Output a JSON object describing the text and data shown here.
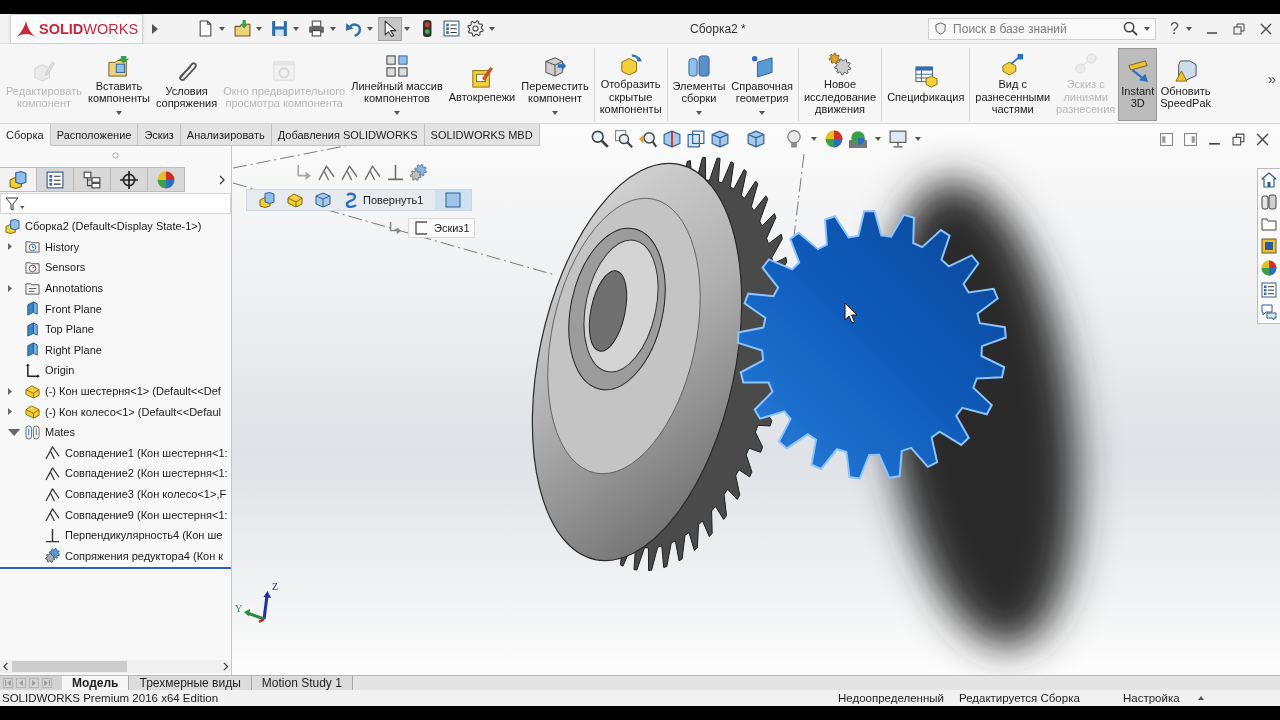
{
  "title_bar": {
    "logo": "**SOLID**WORKS",
    "title": "Сборка2 *",
    "search": {
      "placeholder": "Поиск в базе знаний"
    },
    "help": "?"
  },
  "quick_access": [
    {
      "kind": "new",
      "dropdown": true,
      "pressed": false
    },
    {
      "kind": "open",
      "dropdown": true,
      "pressed": false
    },
    {
      "kind": "save",
      "dropdown": true,
      "pressed": false
    },
    {
      "kind": "print",
      "dropdown": true,
      "pressed": false
    },
    {
      "kind": "undo",
      "dropdown": true,
      "pressed": false
    },
    {
      "kind": "select",
      "dropdown": true,
      "pressed": true
    },
    {
      "kind": "rebuild",
      "dropdown": false,
      "pressed": false
    },
    {
      "kind": "file-properties",
      "dropdown": false,
      "pressed": false
    },
    {
      "kind": "options",
      "dropdown": true,
      "pressed": false
    }
  ],
  "ribbon": {
    "groups": [
      {
        "buttons": [
          {
            "label": "Редактировать\nкомпонент",
            "kind": "edit-component",
            "disabled": true,
            "dropdown": false,
            "selected": false
          },
          {
            "label": "Вставить\nкомпоненты",
            "kind": "insert-components",
            "disabled": false,
            "dropdown": true,
            "selected": false
          },
          {
            "label": "Условия\nсопряжения",
            "kind": "mate",
            "disabled": false,
            "dropdown": false,
            "selected": false
          },
          {
            "label": "Окно предварительного\nпросмотра компонента",
            "kind": "preview",
            "disabled": true,
            "dropdown": false,
            "selected": false
          },
          {
            "label": "Линейный массив\nкомпонентов",
            "kind": "linear-pattern",
            "disabled": false,
            "dropdown": true,
            "selected": false
          },
          {
            "label": "Автокрепежи",
            "kind": "smart-fasteners",
            "disabled": false,
            "dropdown": false,
            "selected": false
          },
          {
            "label": "Переместить\nкомпонент",
            "kind": "move-component",
            "disabled": false,
            "dropdown": true,
            "selected": false
          }
        ]
      },
      {
        "buttons": [
          {
            "label": "Отобразить\nскрытые\nкомпоненты",
            "kind": "show-hidden",
            "disabled": false,
            "dropdown": false,
            "selected": false
          }
        ]
      },
      {
        "buttons": [
          {
            "label": "Элементы\nсборки",
            "kind": "assembly-features",
            "disabled": false,
            "dropdown": true,
            "selected": false
          },
          {
            "label": "Справочная\nгеометрия",
            "kind": "reference-geometry",
            "disabled": false,
            "dropdown": true,
            "selected": false
          }
        ]
      },
      {
        "buttons": [
          {
            "label": "Новое\nисследование\nдвижения",
            "kind": "new-motion-study",
            "disabled": false,
            "dropdown": false,
            "selected": false
          }
        ]
      },
      {
        "buttons": [
          {
            "label": "Спецификация",
            "kind": "bom",
            "disabled": false,
            "dropdown": false,
            "selected": false
          }
        ]
      },
      {
        "buttons": [
          {
            "label": "Вид с\nразнесенными\nчастями",
            "kind": "exploded-view",
            "disabled": false,
            "dropdown": false,
            "selected": false
          },
          {
            "label": "Эскиз с\nлиниями\nразнесения",
            "kind": "explode-line-sketch",
            "disabled": true,
            "dropdown": false,
            "selected": false
          },
          {
            "label": "Instant\n3D",
            "kind": "instant3d",
            "disabled": false,
            "dropdown": false,
            "selected": true
          },
          {
            "label": "Обновить\nSpeedPak",
            "kind": "speedpak",
            "disabled": false,
            "dropdown": false,
            "selected": false
          }
        ]
      }
    ],
    "more": "»"
  },
  "command_tabs": [
    {
      "label": "Сборка",
      "selected": true
    },
    {
      "label": "Расположение",
      "selected": false
    },
    {
      "label": "Эскиз",
      "selected": false
    },
    {
      "label": "Анализировать",
      "selected": false
    },
    {
      "label": "Добавления SOLIDWORKS",
      "selected": false
    },
    {
      "label": "SOLIDWORKS MBD",
      "selected": false
    }
  ],
  "feature_manager": {
    "tabs": [
      {
        "kind": "feature-tree",
        "selected": true
      },
      {
        "kind": "property",
        "selected": false
      },
      {
        "kind": "configuration",
        "selected": false
      },
      {
        "kind": "dimxpert",
        "selected": false
      },
      {
        "kind": "display",
        "selected": false
      }
    ],
    "tree": [
      {
        "label": "Сборка2 (Default<Display State-1>)",
        "kind": "assembly",
        "children": [
          {
            "label": "History",
            "kind": "history",
            "expanded": false
          },
          {
            "label": "Sensors",
            "kind": "sensors"
          },
          {
            "label": "Annotations",
            "kind": "annotations",
            "expanded": false
          },
          {
            "label": "Front Plane",
            "kind": "plane"
          },
          {
            "label": "Top Plane",
            "kind": "plane"
          },
          {
            "label": "Right Plane",
            "kind": "plane"
          },
          {
            "label": "Origin",
            "kind": "origin"
          },
          {
            "label": "(-) Кон шестерня<1> (Default<<Def",
            "kind": "part",
            "expanded": false
          },
          {
            "label": "(-) Кон колесо<1> (Default<<Defaul",
            "kind": "part",
            "expanded": false
          },
          {
            "label": "Mates",
            "kind": "mates",
            "expanded": true,
            "children": [
              {
                "label": "Совпадение1 (Кон шестерня<1:",
                "kind": "coincident"
              },
              {
                "label": "Совпадение2 (Кон шестерня<1:",
                "kind": "coincident"
              },
              {
                "label": "Совпадение3 (Кон колесо<1>,F",
                "kind": "coincident"
              },
              {
                "label": "Совпадение9 (Кон шестерня<1:",
                "kind": "coincident"
              },
              {
                "label": "Перпендикулярность4 (Кон ше",
                "kind": "perpendicular"
              },
              {
                "label": "Сопряжения редуктора4 (Кон к",
                "kind": "gear-mate"
              }
            ]
          }
        ]
      }
    ]
  },
  "viewport": {
    "breadcrumb": {
      "feature": "Повернуть1",
      "sketch": "Эскиз1"
    },
    "triad": {
      "z": "Z",
      "y": "Y"
    }
  },
  "bottom_tabs": [
    {
      "label": "Модель",
      "selected": true
    },
    {
      "label": "Трехмерные виды",
      "selected": false
    },
    {
      "label": "Motion Study 1",
      "selected": false
    }
  ],
  "status_bar": {
    "edition": "SOLIDWORKS Premium 2016 x64 Edition",
    "fields": [
      "Недоопределенный",
      "Редактируется Сборка",
      "Настройка"
    ]
  }
}
